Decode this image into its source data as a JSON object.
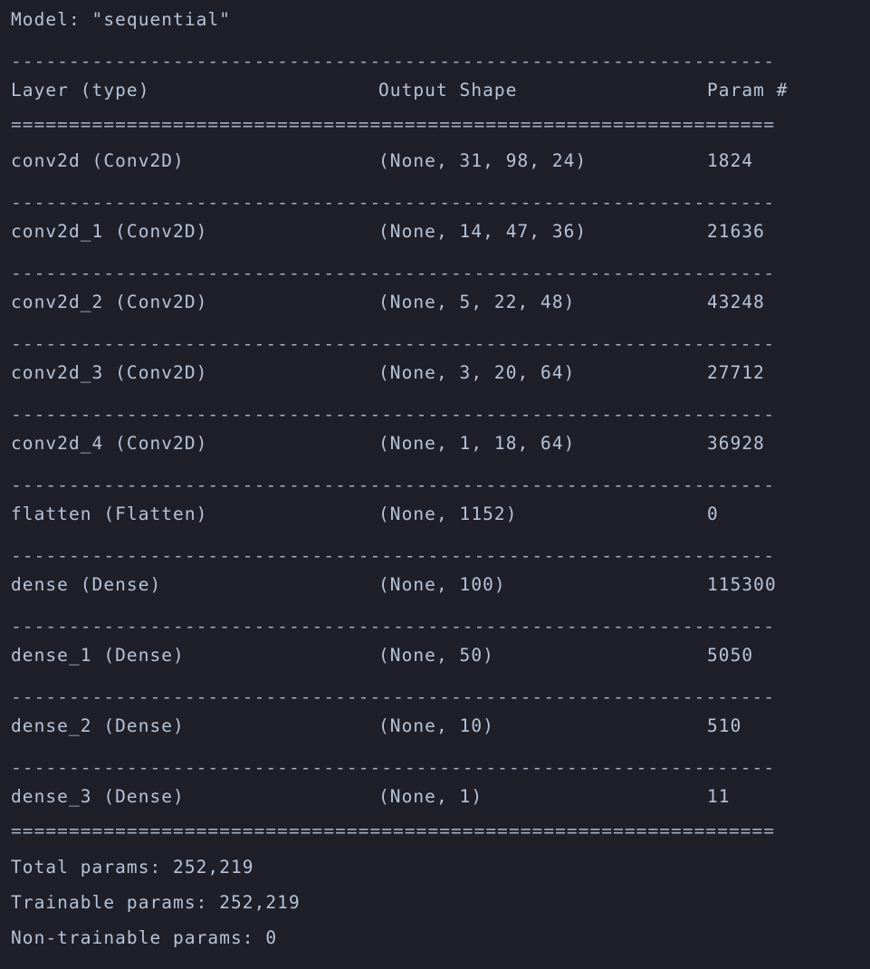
{
  "model_title": "Model: \"sequential\"",
  "headers": {
    "layer": "Layer (type)",
    "output_shape": "Output Shape",
    "params": "Param #"
  },
  "rule_dash": "------------------------------------------------------------------",
  "rule_equal": "==================================================================",
  "layers": [
    {
      "name": "conv2d (Conv2D)",
      "shape": "(None, 31, 98, 24)",
      "params": "1824"
    },
    {
      "name": "conv2d_1 (Conv2D)",
      "shape": "(None, 14, 47, 36)",
      "params": "21636"
    },
    {
      "name": "conv2d_2 (Conv2D)",
      "shape": "(None, 5, 22, 48)",
      "params": "43248"
    },
    {
      "name": "conv2d_3 (Conv2D)",
      "shape": "(None, 3, 20, 64)",
      "params": "27712"
    },
    {
      "name": "conv2d_4 (Conv2D)",
      "shape": "(None, 1, 18, 64)",
      "params": "36928"
    },
    {
      "name": "flatten (Flatten)",
      "shape": "(None, 1152)",
      "params": "0"
    },
    {
      "name": "dense (Dense)",
      "shape": "(None, 100)",
      "params": "115300"
    },
    {
      "name": "dense_1 (Dense)",
      "shape": "(None, 50)",
      "params": "5050"
    },
    {
      "name": "dense_2 (Dense)",
      "shape": "(None, 10)",
      "params": "510"
    },
    {
      "name": "dense_3 (Dense)",
      "shape": "(None, 1)",
      "params": "11"
    }
  ],
  "totals": {
    "total": "Total params: 252,219",
    "trainable": "Trainable params: 252,219",
    "non_trainable": "Non-trainable params: 0"
  },
  "colors": {
    "background": "#1e1f29",
    "text": "#b7c3d7"
  }
}
